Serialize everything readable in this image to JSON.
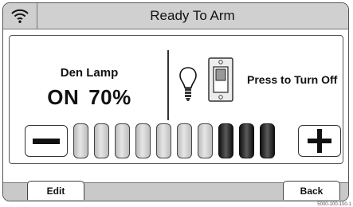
{
  "header": {
    "title": "Ready To Arm",
    "wifi_icon": "wifi-icon"
  },
  "device": {
    "name": "Den Lamp",
    "state": "ON",
    "level": "70%",
    "level_fraction": 0.7,
    "action_label": "Press to Turn Off",
    "bulb_icon": "light-bulb-icon",
    "switch_icon": "wall-switch-icon"
  },
  "dimmer": {
    "decrease_icon": "minus-icon",
    "increase_icon": "plus-icon",
    "segments_total": 10,
    "segments_lit": 3
  },
  "footer": {
    "edit_label": "Edit",
    "back_label": "Back"
  },
  "image_id_text": "5000-100-100-1"
}
